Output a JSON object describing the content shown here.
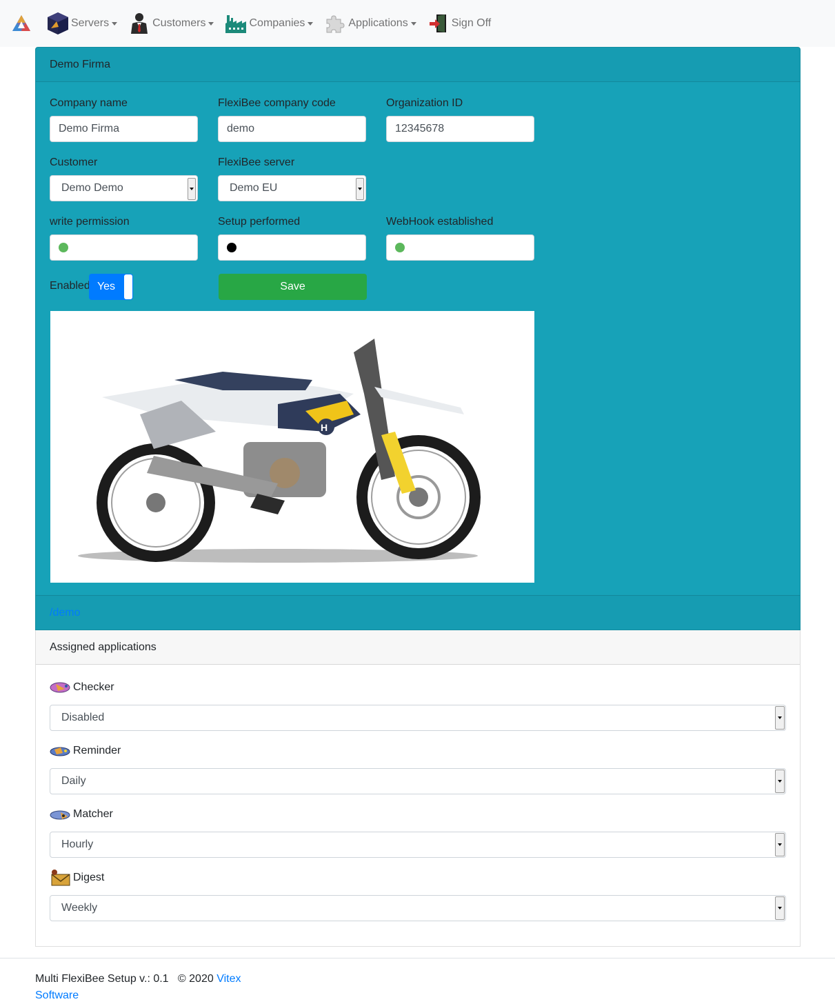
{
  "navbar": {
    "brand_icon": "triangle-logo-icon",
    "items": [
      {
        "label": "Servers",
        "icon": "server-cube-icon",
        "dropdown": true
      },
      {
        "label": "Customers",
        "icon": "customer-person-icon",
        "dropdown": true
      },
      {
        "label": "Companies",
        "icon": "factory-icon",
        "dropdown": true
      },
      {
        "label": "Applications",
        "icon": "puzzle-icon",
        "dropdown": true
      },
      {
        "label": "Sign Off",
        "icon": "sign-off-door-icon",
        "dropdown": false
      }
    ]
  },
  "company": {
    "header": "Demo Firma",
    "company_name": {
      "label": "Company name",
      "value": "Demo Firma"
    },
    "flexibee_code": {
      "label": "FlexiBee company code",
      "value": "demo"
    },
    "organization_id": {
      "label": "Organization ID",
      "value": "12345678"
    },
    "customer": {
      "label": "Customer",
      "value": "Demo Demo"
    },
    "server": {
      "label": "FlexiBee server",
      "value": "Demo EU"
    },
    "write_permission": {
      "label": "write permission",
      "status_color": "#5cb85c"
    },
    "setup_performed": {
      "label": "Setup performed",
      "status_color": "#000000"
    },
    "webhook": {
      "label": "WebHook established",
      "status_color": "#5cb85c"
    },
    "enabled": {
      "label": "Enabled",
      "toggle_label": "Yes",
      "on": true
    },
    "save_label": "Save",
    "logo_image": "motorcycle-photo",
    "footer_link": "/demo"
  },
  "apps": {
    "header": "Assigned applications",
    "items": [
      {
        "name": "Checker",
        "icon": "checker-icon",
        "value": "Disabled"
      },
      {
        "name": "Reminder",
        "icon": "reminder-icon",
        "value": "Daily"
      },
      {
        "name": "Matcher",
        "icon": "matcher-icon",
        "value": "Hourly"
      },
      {
        "name": "Digest",
        "icon": "digest-envelope-icon",
        "value": "Weekly"
      }
    ]
  },
  "footer": {
    "text": "Multi FlexiBee Setup v.: 0.1   © 2020 ",
    "link_label": "Vitex Software"
  },
  "colors": {
    "card_bg": "#17a2b8",
    "primary": "#007bff",
    "success": "#28a745"
  }
}
